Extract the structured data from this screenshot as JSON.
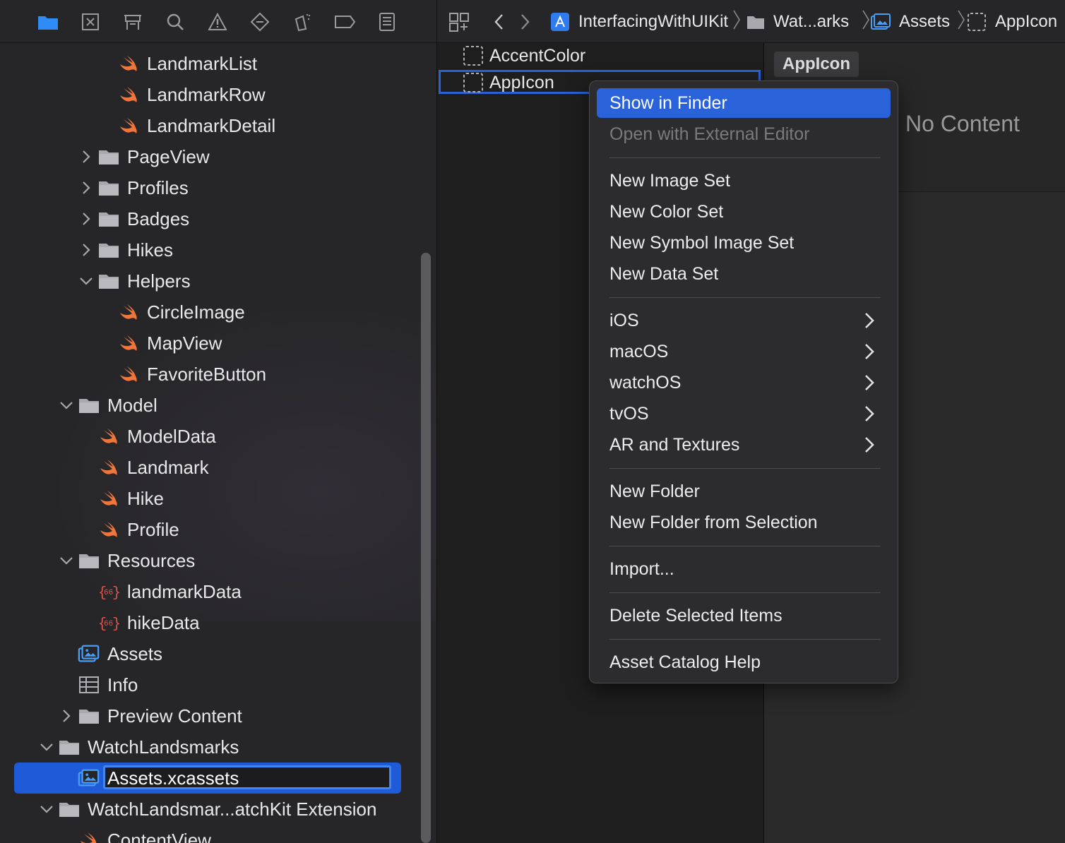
{
  "navigator": {
    "toolbar_icons": [
      "folder-icon",
      "source-control-icon",
      "symbol-icon",
      "find-icon",
      "issue-icon",
      "test-icon",
      "debug-icon",
      "breakpoint-icon",
      "report-icon"
    ],
    "items": [
      {
        "label": "LandmarkList",
        "icon": "swift-file-icon"
      },
      {
        "label": "LandmarkRow",
        "icon": "swift-file-icon"
      },
      {
        "label": "LandmarkDetail",
        "icon": "swift-file-icon"
      },
      {
        "label": "PageView",
        "icon": "folder-icon",
        "disclosure": "collapsed"
      },
      {
        "label": "Profiles",
        "icon": "folder-icon",
        "disclosure": "collapsed"
      },
      {
        "label": "Badges",
        "icon": "folder-icon",
        "disclosure": "collapsed"
      },
      {
        "label": "Hikes",
        "icon": "folder-icon",
        "disclosure": "collapsed"
      },
      {
        "label": "Helpers",
        "icon": "folder-icon",
        "disclosure": "expanded"
      },
      {
        "label": "CircleImage",
        "icon": "swift-file-icon"
      },
      {
        "label": "MapView",
        "icon": "swift-file-icon"
      },
      {
        "label": "FavoriteButton",
        "icon": "swift-file-icon"
      },
      {
        "label": "Model",
        "icon": "folder-icon",
        "disclosure": "expanded"
      },
      {
        "label": "ModelData",
        "icon": "swift-file-icon"
      },
      {
        "label": "Landmark",
        "icon": "swift-file-icon"
      },
      {
        "label": "Hike",
        "icon": "swift-file-icon"
      },
      {
        "label": "Profile",
        "icon": "swift-file-icon"
      },
      {
        "label": "Resources",
        "icon": "folder-icon",
        "disclosure": "expanded"
      },
      {
        "label": "landmarkData",
        "icon": "json-file-icon"
      },
      {
        "label": "hikeData",
        "icon": "json-file-icon"
      },
      {
        "label": "Assets",
        "icon": "asset-catalog-icon"
      },
      {
        "label": "Info",
        "icon": "plist-icon"
      },
      {
        "label": "Preview Content",
        "icon": "folder-icon",
        "disclosure": "collapsed"
      },
      {
        "label": "WatchLandsmarks",
        "icon": "folder-icon",
        "disclosure": "expanded"
      },
      {
        "label": "Assets.xcassets",
        "icon": "asset-catalog-icon",
        "selected": true
      },
      {
        "label": "WatchLandsmar...atchKit Extension",
        "icon": "folder-icon",
        "disclosure": "expanded"
      },
      {
        "label": "ContentView",
        "icon": "swift-file-icon"
      }
    ]
  },
  "jumpbar": {
    "project": "InterfacingWithUIKit",
    "folder": "Wat...arks",
    "catalog": "Assets",
    "asset": "AppIcon"
  },
  "asset_list": [
    {
      "label": "AccentColor"
    },
    {
      "label": "AppIcon",
      "selected": true
    }
  ],
  "detail": {
    "tab": "AppIcon",
    "empty_text": "No Content"
  },
  "context_menu": {
    "groups": [
      [
        {
          "label": "Show in Finder",
          "highlighted": true
        },
        {
          "label": "Open with External Editor",
          "disabled": true
        }
      ],
      [
        {
          "label": "New Image Set"
        },
        {
          "label": "New Color Set"
        },
        {
          "label": "New Symbol Image Set"
        },
        {
          "label": "New Data Set"
        }
      ],
      [
        {
          "label": "iOS",
          "submenu": true
        },
        {
          "label": "macOS",
          "submenu": true
        },
        {
          "label": "watchOS",
          "submenu": true
        },
        {
          "label": "tvOS",
          "submenu": true
        },
        {
          "label": "AR and Textures",
          "submenu": true
        }
      ],
      [
        {
          "label": "New Folder"
        },
        {
          "label": "New Folder from Selection"
        }
      ],
      [
        {
          "label": "Import..."
        }
      ],
      [
        {
          "label": "Delete Selected Items"
        }
      ],
      [
        {
          "label": "Asset Catalog Help"
        }
      ]
    ]
  },
  "colors": {
    "swift": "#f0763c",
    "json": "#e0574f",
    "folder": "#a9a9ad",
    "accent": "#2a63d9",
    "asset_icon": "#4a9ef5"
  }
}
